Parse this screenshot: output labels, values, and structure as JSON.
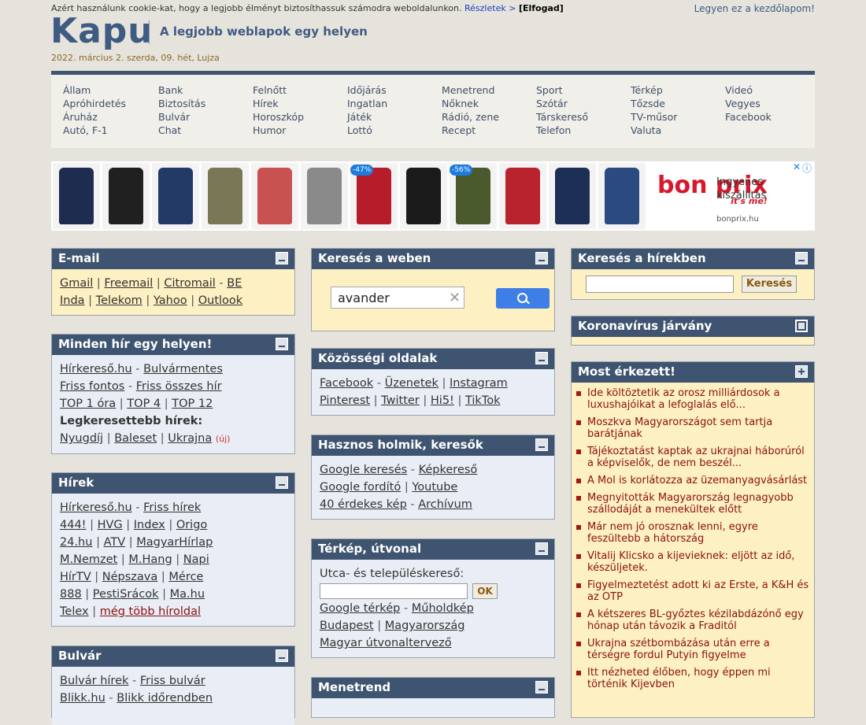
{
  "topbar": {
    "cookie_text": "Azért használunk cookie-kat, hogy a legjobb élményt biztosíthassuk számodra weboldalunkon.",
    "details_link": "Részletek >",
    "accept": "[Elfogad]",
    "homepage_link": "Legyen ez a kezdőlapom!"
  },
  "header": {
    "logo": "Kapu",
    "tagline": "A legjobb weblapok egy helyen",
    "date": "2022. március 2. szerda, 09. hét, Lujza"
  },
  "categories": [
    [
      "Állam",
      "Apróhirdetés",
      "Áruház",
      "Autó, F-1"
    ],
    [
      "Bank",
      "Biztosítás",
      "Bulvár",
      "Chat"
    ],
    [
      "Felnőtt",
      "Hírek",
      "Horoszkóp",
      "Humor"
    ],
    [
      "Időjárás",
      "Ingatlan",
      "Játék",
      "Lottó"
    ],
    [
      "Menetrend",
      "Nőknek",
      "Rádió, zene",
      "Recept"
    ],
    [
      "Sport",
      "Szótár",
      "Társkereső",
      "Telefon"
    ],
    [
      "Térkép",
      "Tőzsde",
      "TV-műsor",
      "Valuta"
    ],
    [
      "Videó",
      "Vegyes",
      "Facebook"
    ]
  ],
  "ad": {
    "badge1": "-47%",
    "badge2": "-56%",
    "brand": "bon prix",
    "brand_sub": "it's me!",
    "promo_line1": "Ingyenes",
    "promo_line2": "kiszállítás",
    "domain": "bonprix.hu",
    "colors": [
      "#1d2c4f",
      "#202020",
      "#243a66",
      "#7a7757",
      "#c8524f",
      "#8a8a8a",
      "#b71c2a",
      "#1b1b1b",
      "#4b5a2c",
      "#b9232e",
      "#1e2f56",
      "#2a4a80"
    ]
  },
  "email": {
    "title": "E-mail",
    "row1": [
      "Gmail",
      "Freemail",
      "Citromail",
      "BE"
    ],
    "row2": [
      "Inda",
      "Telekom",
      "Yahoo",
      "Outlook"
    ]
  },
  "minden": {
    "title": "Minden hír egy helyen!",
    "r1": [
      "Hírkereső.hu",
      "Bulvármentes"
    ],
    "r2": [
      "Friss fontos",
      "Friss összes hír"
    ],
    "r3": [
      "TOP 1 óra",
      "TOP 4",
      "TOP 12"
    ],
    "bold": "Legkeresettebb hírek:",
    "r5": [
      "Nyugdíj",
      "Baleset",
      "Ukrajna"
    ],
    "new": "(új)"
  },
  "hirek": {
    "title": "Hírek",
    "r1": [
      "Hírkereső.hu",
      "Friss hírek"
    ],
    "r2": [
      "444!",
      "HVG",
      "Index",
      "Origo"
    ],
    "r3": [
      "24.hu",
      "ATV",
      "MagyarHírlap"
    ],
    "r4": [
      "M.Nemzet",
      "M.Hang",
      "Napi"
    ],
    "r5": [
      "HírTV",
      "Népszava",
      "Mérce"
    ],
    "r6": [
      "888",
      "PestiSrácok",
      "Ma.hu"
    ],
    "r7": [
      "Telex",
      "még több híroldal"
    ]
  },
  "bulvar": {
    "title": "Bulvár",
    "r1": [
      "Bulvár hírek",
      "Friss bulvár"
    ],
    "r2": [
      "Blikk.hu",
      "Blikk időrendben"
    ]
  },
  "websearch": {
    "title": "Keresés a weben",
    "value": "avander"
  },
  "kozossegi": {
    "title": "Közösségi oldalak",
    "r1": [
      "Facebook",
      "Üzenetek",
      "Instagram"
    ],
    "r2": [
      "Pinterest",
      "Twitter",
      "Hi5!",
      "TikTok"
    ]
  },
  "hasznos": {
    "title": "Hasznos holmik, keresők",
    "r1": [
      "Google keresés",
      "Képkereső"
    ],
    "r2": [
      "Google fordító",
      "Youtube"
    ],
    "r3": [
      "40 érdekes kép",
      "Archívum"
    ]
  },
  "terkep": {
    "title": "Térkép, útvonal",
    "label": "Utca- és településkereső:",
    "ok": "OK",
    "r1": [
      "Google térkép",
      "Műholdkép"
    ],
    "r2": [
      "Budapest",
      "Magyarország"
    ],
    "r3": "Magyar útvonaltervező"
  },
  "menetrend": {
    "title": "Menetrend"
  },
  "newssearch": {
    "title": "Keresés a hírekben",
    "button": "Keresés"
  },
  "korona": {
    "title": "Koronavírus járvány"
  },
  "most": {
    "title": "Most érkezett!",
    "items": [
      "Ide költöztetik az orosz milliárdosok a luxushajóikat a lefoglalás elő...",
      "Moszkva Magyarországot sem tartja barátjának",
      "Tájékoztatást kaptak az ukrajnai háborúról a képviselők, de nem beszél...",
      "A Mol is korlátozza az üzemanyagvásárlást",
      "Megnyitották Magyarország legnagyobb szállodáját a menekültek előtt",
      "Már nem jó orosznak lenni, egyre feszültebb a hátország",
      "Vitalij Klicsko a kijevieknek: eljött az idő, készüljetek.",
      "Figyelmeztetést adott ki az Erste, a K&H és az OTP",
      "A kétszeres BL-győztes kézilabdázónő egy hónap után távozik a Fraditól",
      "Ukrajna szétbombázása után erre a térségre fordul Putyin figyelme",
      "Itt nézheted élőben, hogy éppen mi történik Kijevben"
    ]
  }
}
